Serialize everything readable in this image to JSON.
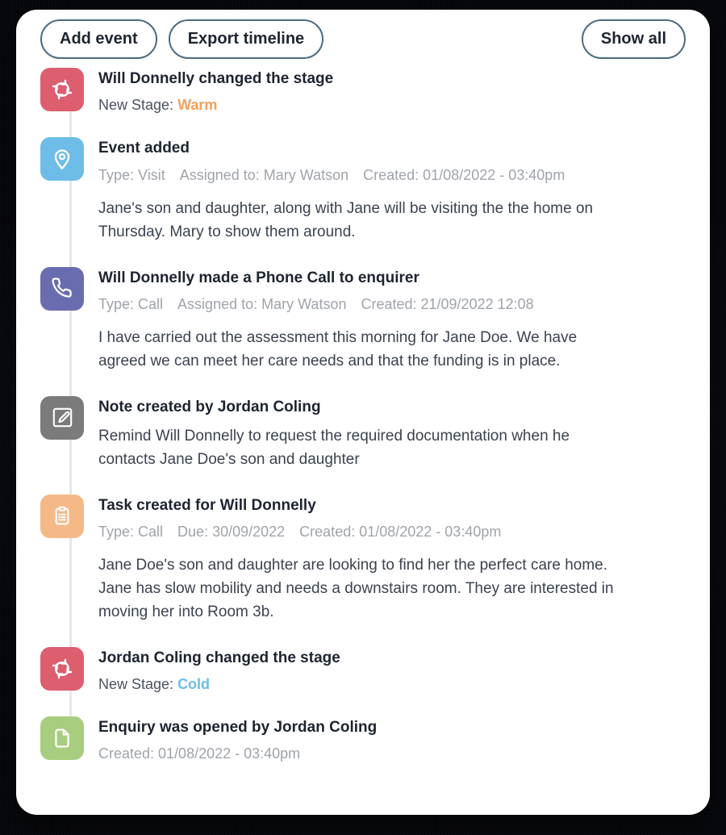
{
  "toolbar": {
    "add_event_label": "Add event",
    "export_timeline_label": "Export timeline",
    "show_all_label": "Show all"
  },
  "colors": {
    "stage_change": "#dd5e6f",
    "visit": "#6dbde8",
    "call": "#6a6cb0",
    "note": "#7b7b7b",
    "task": "#f5b988",
    "enquiry": "#a8cd7f",
    "warm": "#f5a05a",
    "cold": "#6dbde8",
    "button_border": "#4a6a82",
    "timeline_line": "#e7e7e9"
  },
  "events": [
    {
      "icon": "refresh-cycle-icon",
      "title": "Will Donnelly changed the stage",
      "stage_label": "New Stage: ",
      "stage_value": "Warm"
    },
    {
      "icon": "location-pin-icon",
      "title": "Event added",
      "meta_type": "Type: Visit",
      "meta_assigned": "Assigned to: Mary Watson",
      "meta_created": "Created: 01/08/2022  -  03:40pm",
      "description": "Jane's son and daughter, along with Jane will be visiting the the home on Thursday. Mary to show them around."
    },
    {
      "icon": "phone-icon",
      "title": "Will Donnelly made a Phone Call to enquirer",
      "meta_type": "Type: Call",
      "meta_assigned": "Assigned to: Mary Watson",
      "meta_created": "Created: 21/09/2022 12:08",
      "description": "I have carried out the assessment this morning for Jane Doe. We have agreed we can meet her care needs and that the funding is in place."
    },
    {
      "icon": "edit-pencil-icon",
      "title": "Note created by Jordan Coling",
      "description": "Remind Will Donnelly to request the required documentation when he contacts Jane Doe's son and daughter"
    },
    {
      "icon": "clipboard-task-icon",
      "title": "Task created for Will Donnelly",
      "meta_type": "Type: Call",
      "meta_due": "Due: 30/09/2022",
      "meta_created": "Created: 01/08/2022  -  03:40pm",
      "description": "Jane Doe's son and daughter are looking to find her the perfect care home. Jane has slow mobility and needs a downstairs room. They are interested in moving her into Room 3b."
    },
    {
      "icon": "refresh-cycle-icon",
      "title": "Jordan Coling changed the stage",
      "stage_label": "New Stage: ",
      "stage_value": "Cold"
    },
    {
      "icon": "document-icon",
      "title": "Enquiry was opened by Jordan Coling",
      "meta_created": "Created: 01/08/2022  -  03:40pm"
    }
  ]
}
